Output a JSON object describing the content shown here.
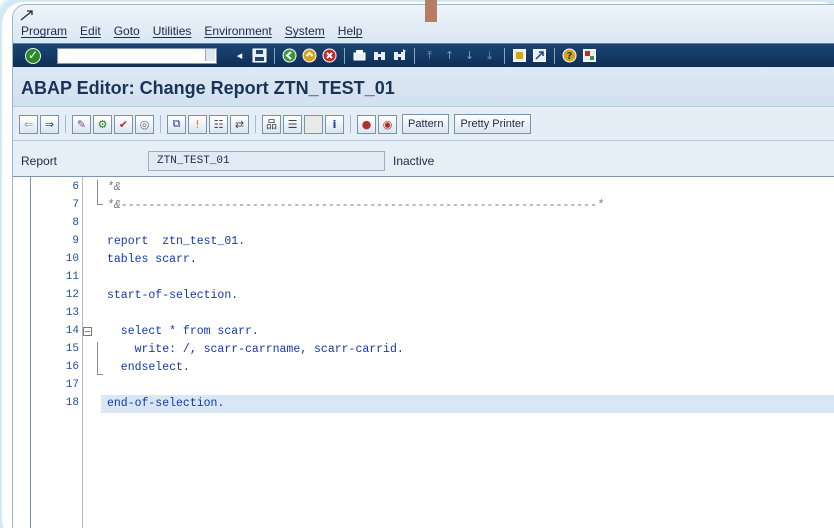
{
  "menu": [
    "Program",
    "Edit",
    "Goto",
    "Utilities",
    "Environment",
    "System",
    "Help"
  ],
  "icons": {
    "menu_glyph": "window-menu-icon",
    "enter": "enter-check-icon",
    "save": "save-icon",
    "back": "back-icon",
    "exit": "exit-icon",
    "cancel": "cancel-icon",
    "print": "print-icon",
    "find": "find-icon",
    "find_next": "find-next-icon",
    "help": "help-icon",
    "customize": "customize-layout-icon"
  },
  "title": "ABAP Editor: Change Report ZTN_TEST_01",
  "toolbar": {
    "pattern_label": "Pattern",
    "pretty_printer_label": "Pretty Printer"
  },
  "report": {
    "label": "Report",
    "value": "ZTN_TEST_01",
    "status": "Inactive"
  },
  "code_lines": [
    {
      "no": "6",
      "text": "*&",
      "comment": true
    },
    {
      "no": "7",
      "text": "*&---------------------------------------------------------------------*",
      "comment": true
    },
    {
      "no": "8",
      "text": "",
      "comment": false
    },
    {
      "no": "9",
      "text": "report  ztn_test_01.",
      "comment": false
    },
    {
      "no": "10",
      "text": "tables scarr.",
      "comment": false
    },
    {
      "no": "11",
      "text": "",
      "comment": false
    },
    {
      "no": "12",
      "text": "start-of-selection.",
      "comment": false
    },
    {
      "no": "13",
      "text": "",
      "comment": false
    },
    {
      "no": "14",
      "text": "  select * from scarr.",
      "comment": false
    },
    {
      "no": "15",
      "text": "    write: /, scarr-carrname, scarr-carrid.",
      "comment": false
    },
    {
      "no": "16",
      "text": "  endselect.",
      "comment": false
    },
    {
      "no": "17",
      "text": "",
      "comment": false
    },
    {
      "no": "18",
      "text": "end-of-selection.",
      "comment": false
    }
  ],
  "colors": {
    "code": "#1438a8",
    "comment": "#7a7a7a",
    "line_numbers": "#1f4fa0",
    "current_line": "#d8e6f5",
    "system_toolbar": "#0d2f57"
  }
}
